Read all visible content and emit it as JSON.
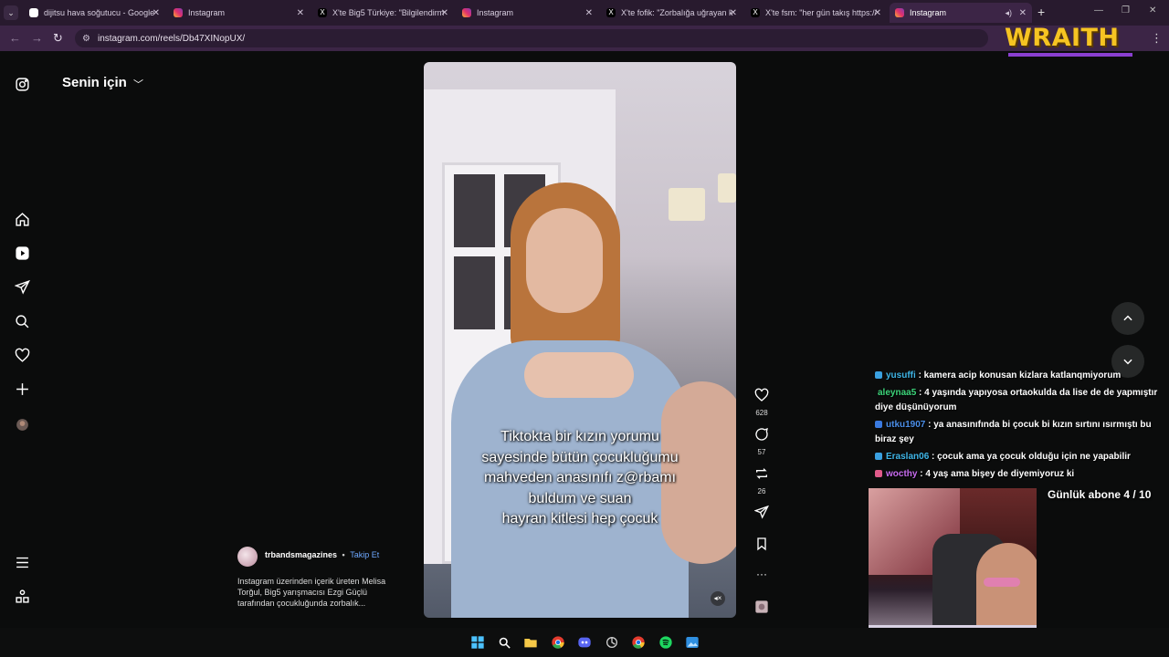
{
  "browser": {
    "tabs": [
      {
        "title": "dijitsu hava soğutucu - Google",
        "favicon": "google-icon",
        "active": false
      },
      {
        "title": "Instagram",
        "favicon": "instagram-icon",
        "active": false
      },
      {
        "title": "X'te Big5 Türkiye: \"Bilgilendirm",
        "favicon": "x-icon",
        "active": false
      },
      {
        "title": "Instagram",
        "favicon": "instagram-icon",
        "active": false
      },
      {
        "title": "X'te fofik: \"Zorbalığa uğrayan k",
        "favicon": "x-icon",
        "active": false
      },
      {
        "title": "X'te fsm: \"her gün takış https://",
        "favicon": "x-icon",
        "active": false
      },
      {
        "title": "Instagram",
        "favicon": "instagram-icon",
        "active": true
      }
    ],
    "url": "instagram.com/reels/Db47XINopUX/",
    "overlay_brand": "WRAITH"
  },
  "instagram": {
    "feed_title": "Senin için",
    "reel": {
      "caption_lines": [
        "Tiktokta bir kızın yorumu",
        "sayesinde bütün çocukluğumu",
        "mahveden anasınıfı z@rbamı",
        "buldum ve suan",
        "hayran kitlesi hep çocuk"
      ]
    },
    "actions": {
      "likes": "628",
      "comments": "57",
      "reposts": "26"
    },
    "post": {
      "author": "trbandsmagazines",
      "separator": "•",
      "follow_label": "Takip Et",
      "description": "Instagram üzerinden içerik üreten Melisa Torğul, Big5 yarışmacısı Ezgi Güçlü tarafından çocukluğunda zorbalık..."
    }
  },
  "chat": [
    {
      "user": "yusuffi",
      "text": ": kamera acip konusan kizlara katlanqmiyorum",
      "color": "#3fb6e8",
      "badge": "#3aa0e0"
    },
    {
      "user": "aleynaa5",
      "text": ": 4 yaşında yapıyosa ortaokulda da lise de de yapmıştır diye düşünüyorum",
      "color": "#3dd47a",
      "badge": ""
    },
    {
      "user": "utku1907",
      "text": ": ya anasınıfında bi çocuk bi kızın sırtını ısırmıştı bu biraz şey",
      "color": "#4b8ee8",
      "badge": "#3a7ae0"
    },
    {
      "user": "Eraslan06",
      "text": ": çocuk ama ya çocuk olduğu için ne yapabilir",
      "color": "#3fb6e8",
      "badge": "#3aa0e0"
    },
    {
      "user": "wocthy",
      "text": ": 4 yaş ama bişey de diyemiyoruz ki",
      "color": "#c86cf0",
      "badge": "#e05a8a"
    }
  ],
  "stream": {
    "sub_goal": "Günlük abone 4 / 10"
  }
}
